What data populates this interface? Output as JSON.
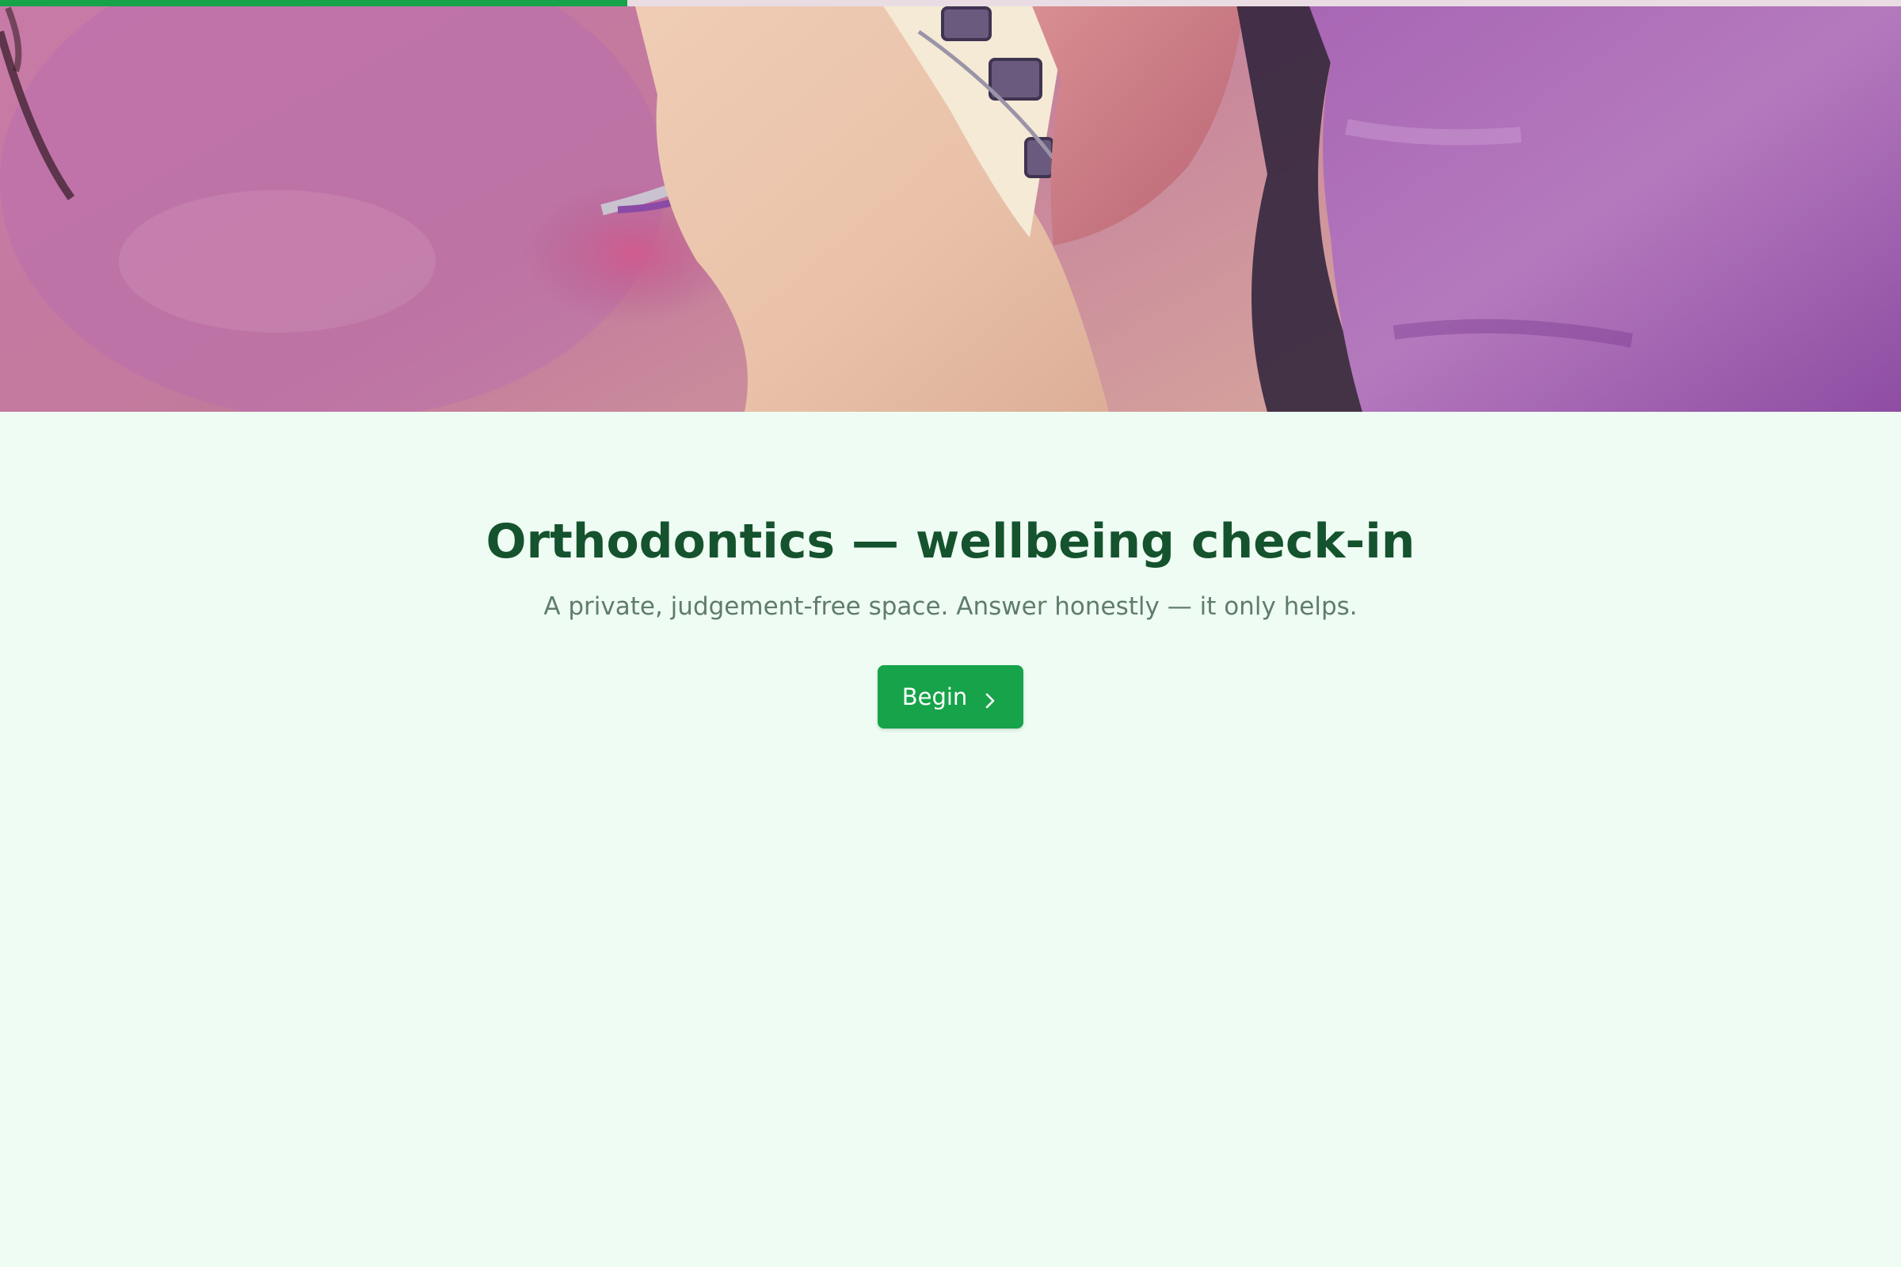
{
  "progress": {
    "fraction": 0.33,
    "fill_color": "#16a34a",
    "track_color": "#e9dde3"
  },
  "hero": {
    "image": "orthodontic-braces-photo"
  },
  "page": {
    "title": "Orthodontics — wellbeing check-in",
    "subtitle": "A private, judgement-free space. Answer honestly — it only helps."
  },
  "actions": {
    "begin_label": "Begin",
    "begin_icon": "chevron-right-icon"
  },
  "colors": {
    "accent": "#16a34a",
    "title": "#14532d",
    "subtitle": "#5f7d6a",
    "background": "#effcf3"
  }
}
